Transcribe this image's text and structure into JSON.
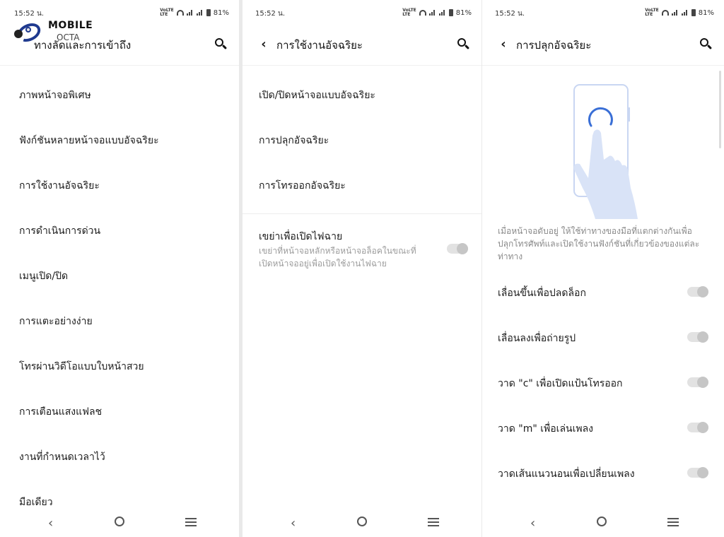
{
  "status": {
    "time": "15:52 น.",
    "battery": "81%"
  },
  "logo": {
    "line1": "MOBILE",
    "line2": "OCTA"
  },
  "screen1": {
    "title": "ทางลัดและการเข้าถึง",
    "items": [
      "ภาพหน้าจอพิเศษ",
      "ฟังก์ชันหลายหน้าจอแบบอัจฉริยะ",
      "การใช้งานอัจฉริยะ",
      "การดำเนินการด่วน",
      "เมนูเปิด/ปิด",
      "การแตะอย่างง่าย",
      "โทรผ่านวิดีโอแบบใบหน้าสวย",
      "การเตือนแสงแฟลช",
      "งานที่กำหนดเวลาไว้",
      "มือเดียว"
    ]
  },
  "screen2": {
    "title": "การใช้งานอัจฉริยะ",
    "items": [
      "เปิด/ปิดหน้าจอแบบอัจฉริยะ",
      "การปลุกอัจฉริยะ",
      "การโทรออกอัจฉริยะ"
    ],
    "shake": {
      "label": "เขย่าเพื่อเปิดไฟฉาย",
      "description": "เขย่าที่หน้าจอหลักหรือหน้าจอล็อคในขณะที่เปิดหน้าจออยู่เพื่อเปิดใช้งานไฟฉาย",
      "enabled": false
    }
  },
  "screen3": {
    "title": "การปลุกอัจฉริยะ",
    "description": "เมื่อหน้าจอดับอยู่ ให้ใช้ท่าทางของมือที่แตกต่างกันเพื่อปลุกโทรศัพท์และเปิดใช้งานฟังก์ชันที่เกี่ยวข้องของแต่ละท่าทาง",
    "toggles": [
      {
        "label": "เลื่อนขึ้นเพื่อปลดล็อก",
        "enabled": false
      },
      {
        "label": "เลื่อนลงเพื่อถ่ายรูป",
        "enabled": false
      },
      {
        "label": "วาด \"c\" เพื่อเปิดแป้นโทรออก",
        "enabled": false
      },
      {
        "label": "วาด \"m\" เพื่อเล่นเพลง",
        "enabled": false
      },
      {
        "label": "วาดเส้นแนวนอนเพื่อเปลี่ยนเพลง",
        "enabled": false
      }
    ]
  },
  "icons": {
    "back": "chevron-left-icon",
    "search": "search-icon",
    "nav_back": "nav-back-icon",
    "nav_home": "nav-home-icon",
    "nav_recents": "nav-recents-icon"
  },
  "colors": {
    "toggle_off_track": "#e2e2e2",
    "toggle_off_knob": "#c6c6c6",
    "illustration_hand": "#d9e3f7",
    "illustration_arc": "#3a6fd6"
  }
}
